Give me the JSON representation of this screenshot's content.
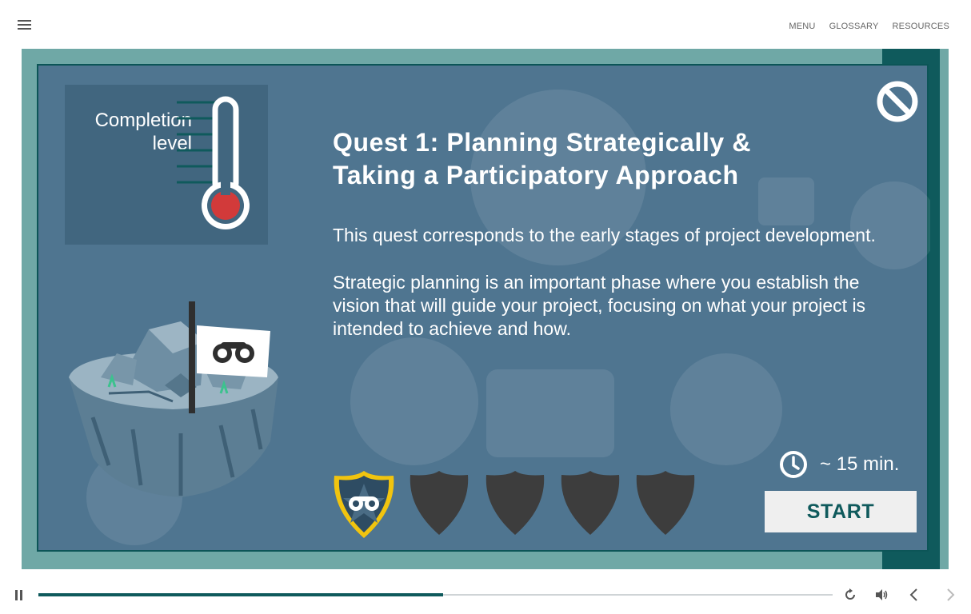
{
  "topnav": {
    "menu": "MENU",
    "glossary": "GLOSSARY",
    "resources": "RESOURCES"
  },
  "completion": {
    "label": "Completion level",
    "line1": "Completion",
    "line2": "level"
  },
  "quest": {
    "title_line1": "Quest 1: Planning Strategically &",
    "title_line2": "Taking a Participatory Approach",
    "paragraph1": "This quest corresponds to the early stages of project development.",
    "paragraph2": "Strategic planning is an important phase where you establish the vision that will guide your project, focusing on what your project is intended to achieve and how."
  },
  "badges": {
    "total": 5,
    "unlocked": 1,
    "unlocked_icon": "binoculars-star-badge-icon",
    "locked_icon": "locked-shield-icon"
  },
  "duration": {
    "icon": "clock-icon",
    "text": "~ 15 min."
  },
  "start_button": {
    "label": "START"
  },
  "player": {
    "progress": 0.51
  },
  "colors": {
    "panel": "#4f7590",
    "frame": "#6fa8a6",
    "accent_dark_teal": "#0f5a5c",
    "thermo_bulb": "#d23a3a",
    "badge_gold": "#f1c40f"
  }
}
